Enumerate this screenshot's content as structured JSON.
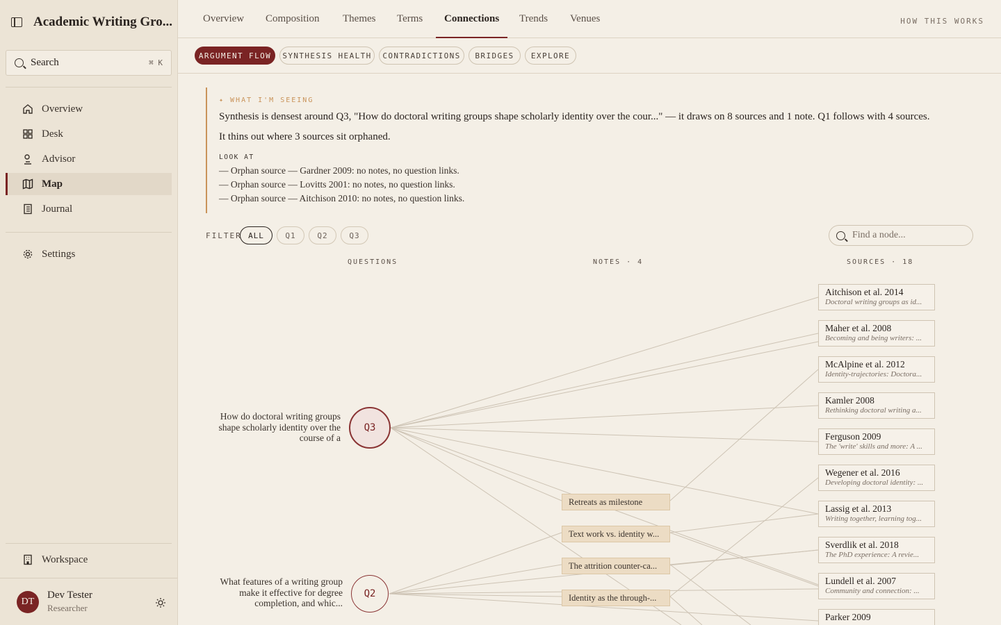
{
  "app": {
    "title": "Academic Writing Gro..."
  },
  "search": {
    "label": "Search",
    "shortcut": "⌘ K"
  },
  "sidebar": {
    "items": [
      {
        "label": "Overview",
        "icon": "home-icon"
      },
      {
        "label": "Desk",
        "icon": "grid-icon"
      },
      {
        "label": "Advisor",
        "icon": "advisor-icon"
      },
      {
        "label": "Map",
        "icon": "map-icon",
        "active": true
      },
      {
        "label": "Journal",
        "icon": "journal-icon"
      }
    ],
    "settings": "Settings",
    "workspace": "Workspace"
  },
  "user": {
    "initials": "DT",
    "name": "Dev Tester",
    "role": "Researcher"
  },
  "tabs": [
    "Overview",
    "Composition",
    "Themes",
    "Terms",
    "Connections",
    "Trends",
    "Venues"
  ],
  "active_tab": "Connections",
  "how_link": "HOW THIS WORKS",
  "subtabs": [
    "ARGUMENT FLOW",
    "SYNTHESIS HEALTH",
    "CONTRADICTIONS",
    "BRIDGES",
    "EXPLORE"
  ],
  "insight": {
    "label": "✦ WHAT I'M SEEING",
    "p1": "Synthesis is densest around Q3, \"How do doctoral writing groups shape scholarly identity over the cour...\" — it draws on 8 sources and 1 note. Q1 follows with 4 sources.",
    "p2": "It thins out where 3 sources sit orphaned.",
    "look_label": "LOOK AT",
    "look_items": [
      "— Orphan source — Gardner 2009: no notes, no question links.",
      "— Orphan source — Lovitts 2001: no notes, no question links.",
      "— Orphan source — Aitchison 2010: no notes, no question links."
    ]
  },
  "filter": {
    "label": "FILTER",
    "chips": [
      "ALL",
      "Q1",
      "Q2",
      "Q3"
    ],
    "active": "ALL"
  },
  "find": {
    "placeholder": "Find a node..."
  },
  "columns": {
    "questions": "QUESTIONS",
    "notes": "NOTES · 4",
    "sources": "SOURCES · 18"
  },
  "questions": [
    {
      "id": "Q3",
      "text": "How do doctoral writing groups shape scholarly identity over the course of a"
    },
    {
      "id": "Q2",
      "text": "What features of a writing group make it effective for degree completion, and whic..."
    }
  ],
  "notes": [
    "Retreats as milestone",
    "Text work vs. identity w...",
    "The attrition counter-ca...",
    "Identity as the through-..."
  ],
  "sources": [
    {
      "name": "Aitchison et al. 2014",
      "title": "Doctoral writing groups as id..."
    },
    {
      "name": "Maher et al. 2008",
      "title": "Becoming and being writers: ..."
    },
    {
      "name": "McAlpine et al. 2012",
      "title": "Identity-trajectories: Doctora..."
    },
    {
      "name": "Kamler 2008",
      "title": "Rethinking doctoral writing a..."
    },
    {
      "name": "Ferguson 2009",
      "title": "The 'write' skills and more: A ..."
    },
    {
      "name": "Wegener et al. 2016",
      "title": "Developing doctoral identity: ..."
    },
    {
      "name": "Lassig et al. 2013",
      "title": "Writing together, learning tog..."
    },
    {
      "name": "Sverdlik et al. 2018",
      "title": "The PhD experience: A revie..."
    },
    {
      "name": "Lundell et al. 2007",
      "title": "Community and connection: ..."
    },
    {
      "name": "Parker 2009",
      "title": ""
    }
  ],
  "colors": {
    "accent": "#7a2424",
    "insight": "#c9935a",
    "line": "#cfc5b6"
  }
}
